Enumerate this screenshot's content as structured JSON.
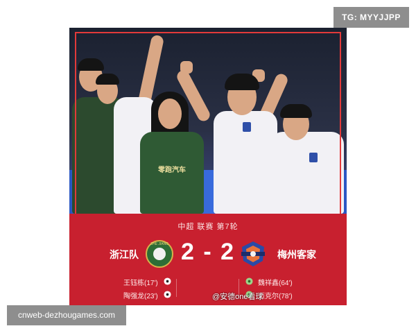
{
  "overlay": {
    "tg_label": "TG: MYYJJPP",
    "site_label": "cnweb-dezhougames.com"
  },
  "card": {
    "league": "中超 联赛 第7轮",
    "home_team": "浙江队",
    "away_team": "梅州客家",
    "home_score": "2",
    "away_score": "2",
    "score_separator": "-",
    "home_scorers": [
      "王钰栋(17')",
      "陶强龙(23')"
    ],
    "away_scorers": [
      "魏祥鑫(64')",
      "迈克尔(78')"
    ],
    "home_crest_text": "ZHE JIANG",
    "jersey_sponsor": "零跑汽车",
    "watermark": "@安德one看球",
    "accent_color": "#c8202f"
  }
}
